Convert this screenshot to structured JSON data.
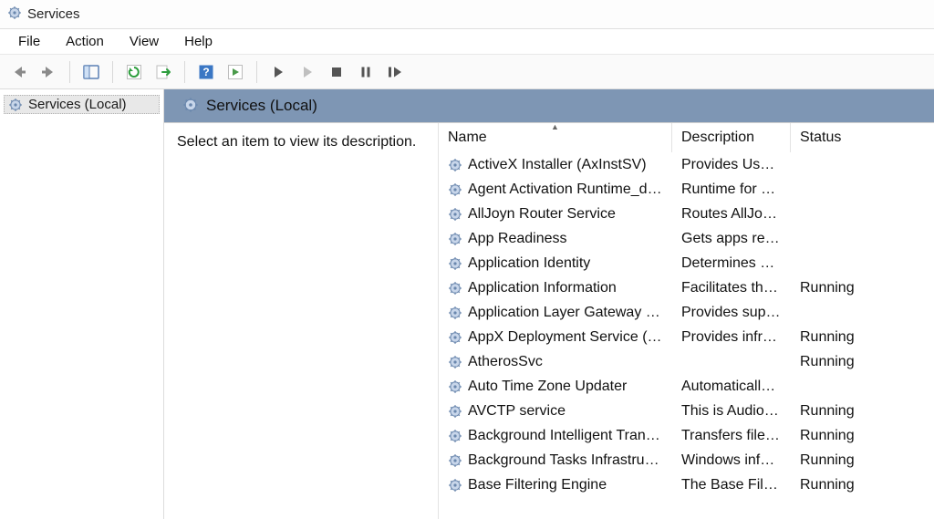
{
  "window": {
    "title": "Services"
  },
  "menu": {
    "file": "File",
    "action": "Action",
    "view": "View",
    "help": "Help"
  },
  "tree": {
    "root": "Services (Local)"
  },
  "header": {
    "title": "Services (Local)"
  },
  "description_placeholder": "Select an item to view its description.",
  "columns": {
    "name": "Name",
    "description": "Description",
    "status": "Status"
  },
  "services": [
    {
      "name": "ActiveX Installer (AxInstSV)",
      "desc": "Provides Use…",
      "status": ""
    },
    {
      "name": "Agent Activation Runtime_d…",
      "desc": "Runtime for …",
      "status": ""
    },
    {
      "name": "AllJoyn Router Service",
      "desc": "Routes AllJo…",
      "status": ""
    },
    {
      "name": "App Readiness",
      "desc": "Gets apps re…",
      "status": ""
    },
    {
      "name": "Application Identity",
      "desc": "Determines …",
      "status": ""
    },
    {
      "name": "Application Information",
      "desc": "Facilitates th…",
      "status": "Running"
    },
    {
      "name": "Application Layer Gateway S…",
      "desc": "Provides sup…",
      "status": ""
    },
    {
      "name": "AppX Deployment Service (A…",
      "desc": "Provides infr…",
      "status": "Running"
    },
    {
      "name": "AtherosSvc",
      "desc": "",
      "status": "Running"
    },
    {
      "name": "Auto Time Zone Updater",
      "desc": "Automaticall…",
      "status": ""
    },
    {
      "name": "AVCTP service",
      "desc": "This is Audio…",
      "status": "Running"
    },
    {
      "name": "Background Intelligent Tran…",
      "desc": "Transfers file…",
      "status": "Running"
    },
    {
      "name": "Background Tasks Infrastruc…",
      "desc": "Windows inf…",
      "status": "Running"
    },
    {
      "name": "Base Filtering Engine",
      "desc": "The Base Filt…",
      "status": "Running"
    }
  ]
}
